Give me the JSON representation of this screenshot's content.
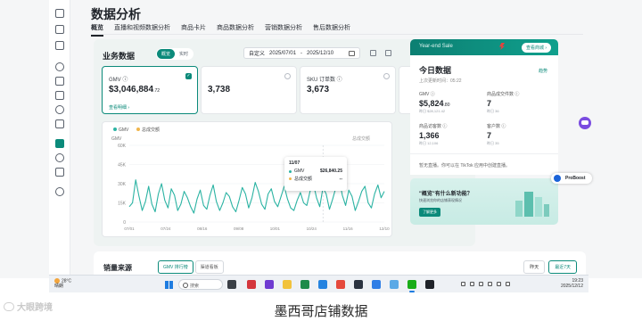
{
  "page": {
    "title": "数据分析",
    "tabs": [
      "概览",
      "直播和视频数据分析",
      "商品卡片",
      "商品数据分析",
      "营销数据分析",
      "售后数据分析"
    ]
  },
  "business": {
    "title": "业务数据",
    "toggle": [
      "概览",
      "实时"
    ],
    "date_label": "自定义",
    "date_from": "2025/07/01",
    "date_sep": "-",
    "date_to": "2025/12/10",
    "kpis": [
      {
        "label": "GMV ⓘ",
        "value": "$3,046,884",
        "decimals": ".72",
        "link": "查看明细 ›",
        "selected": true
      },
      {
        "label": "",
        "value": "3,738",
        "decimals": "",
        "link": "",
        "selected": false
      },
      {
        "label": "SKU 订单数 ⓘ",
        "value": "3,673",
        "decimals": "",
        "link": "",
        "selected": false
      }
    ]
  },
  "chart_legend": {
    "gmv": "GMV",
    "orders": "总成交额",
    "right_note": "总成交额"
  },
  "tooltip": {
    "date": "11/07",
    "gmv_label": "GMV",
    "gmv_value": "$26,840.25",
    "orders_label": "总成交额",
    "orders_value": "--"
  },
  "chart_data": {
    "type": "line",
    "ylabel": "GMV",
    "yticks": [
      "60K",
      "45K",
      "30K",
      "15K",
      "0"
    ],
    "ylim": [
      0,
      60000
    ],
    "xticks": [
      "07/01",
      "07/24",
      "08/16",
      "09/08",
      "10/01",
      "10/24",
      "11/16",
      "12/10"
    ],
    "series": [
      {
        "name": "GMV",
        "color": "#2bb3a3",
        "values": [
          12000,
          15000,
          33000,
          20000,
          9000,
          16000,
          28000,
          14000,
          8000,
          22000,
          30000,
          17000,
          11000,
          26000,
          21000,
          9000,
          14000,
          24000,
          19000,
          12000,
          7000,
          18000,
          25000,
          13000,
          10000,
          21000,
          29000,
          16000,
          9000,
          15000,
          23000,
          20000,
          12000,
          8000,
          17000,
          27000,
          22000,
          11000,
          19000,
          31000,
          24000,
          14000,
          10000,
          22000,
          26000,
          16000,
          12000,
          20000,
          28000,
          18000,
          11000,
          9000,
          17000,
          23000,
          15000,
          13000,
          24000,
          30000,
          19000,
          12000,
          26840,
          22000,
          10000,
          18000,
          27000,
          34000,
          21000,
          13000,
          25000,
          20000,
          9000,
          16000,
          24000,
          28000,
          15000,
          11000,
          22000,
          29000,
          19000,
          24000
        ]
      },
      {
        "name": "总成交额",
        "color": "#f0b54b",
        "values": []
      }
    ]
  },
  "today": {
    "banner_title": "Year-end Sale",
    "banner_button": "查看商城 ›",
    "title": "今日数据",
    "updated": "上次更新时间：05:22",
    "trend": "趋势",
    "cells": [
      {
        "label": "GMV ⓘ",
        "value": "$5,824",
        "decimals": ".80",
        "sub": "昨日 $28,121.42"
      },
      {
        "label": "商品成交件数 ⓘ",
        "value": "7",
        "decimals": "",
        "sub": "昨日 36"
      },
      {
        "label": "商品访客数 ⓘ",
        "value": "1,366",
        "decimals": "",
        "sub": "昨日 12,106"
      },
      {
        "label": "客户数 ⓘ",
        "value": "7",
        "decimals": "",
        "sub": "昨日 35"
      }
    ],
    "live_note": "暂无直播。你可以在 TikTok 应用中创建直播。"
  },
  "promo": {
    "title": "\"概览\"有什么新功能？",
    "desc": "快速浏览你的店铺表现情况",
    "button": "了解更多"
  },
  "proboost": "ProBoost",
  "sales_source": {
    "title": "销量来源",
    "tabs": [
      "GMV 排行榜",
      "渠道看板"
    ],
    "buttons": [
      "昨天",
      "最近7天"
    ]
  },
  "taskbar": {
    "temp": "28°C",
    "weather": "晴朗",
    "search": "搜索",
    "time": "19:23",
    "date": "2025/12/12"
  },
  "footer": {
    "watermark": "大眼跨境",
    "caption": "墨西哥店铺数据"
  }
}
